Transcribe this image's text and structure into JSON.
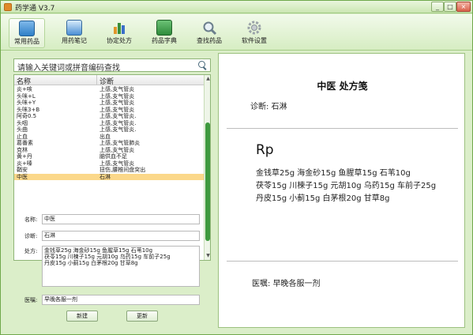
{
  "window": {
    "title": "药学通 V3.7",
    "controls": {
      "minimize": "_",
      "maximize": "□",
      "close": "×"
    }
  },
  "toolbar": {
    "items": [
      {
        "label": "常用药品",
        "icon": "pill-box-icon",
        "color": "#2f7fc7",
        "active": true
      },
      {
        "label": "用药笔记",
        "icon": "notebook-icon",
        "color": "#4a8fd4",
        "active": false
      },
      {
        "label": "协定处方",
        "icon": "bar-chart-icon",
        "color": "#e0962b",
        "active": false
      },
      {
        "label": "药品字典",
        "icon": "green-book-icon",
        "color": "#2e8b3a",
        "active": false
      },
      {
        "label": "查找药品",
        "icon": "magnifier-icon",
        "color": "#7a8d99",
        "active": false
      },
      {
        "label": "软件设置",
        "icon": "gear-icon",
        "color": "#9aa3a8",
        "active": false
      }
    ]
  },
  "search": {
    "text": "请输入关键词或拼音编码查找"
  },
  "list": {
    "headers": {
      "name": "名称",
      "diagnosis": "诊断"
    },
    "rows": [
      {
        "name": "炎+咳",
        "diagnosis": "上感,支气管炎"
      },
      {
        "name": "头咪+L",
        "diagnosis": "上感,支气管炎"
      },
      {
        "name": "头咪+Y",
        "diagnosis": "上感,支气管炎"
      },
      {
        "name": "头咪3+B",
        "diagnosis": "上感,支气管炎"
      },
      {
        "name": "阿奇0.5",
        "diagnosis": "上感,支气管炎."
      },
      {
        "name": "头咽",
        "diagnosis": "上感,支气管炎."
      },
      {
        "name": "头曲",
        "diagnosis": "上感,支气管炎."
      },
      {
        "name": "止血",
        "diagnosis": "出血"
      },
      {
        "name": "葛番素",
        "diagnosis": "上感,支气管肺炎"
      },
      {
        "name": "克林",
        "diagnosis": "上感,支气管炎"
      },
      {
        "name": "黄+丹",
        "diagnosis": "脑供血不足"
      },
      {
        "name": "炎+嗪",
        "diagnosis": "上感,支气管炎"
      },
      {
        "name": "鞘安",
        "diagnosis": "扭伤,腰椎间盘突出"
      },
      {
        "name": "中医",
        "diagnosis": "石淋",
        "selected": true
      }
    ]
  },
  "form": {
    "name_label": "名称:",
    "name_value": "中医",
    "diag_label": "诊断:",
    "diag_value": "石淋",
    "rx_label": "处方:",
    "rx_lines": [
      "金钱草25g  海金砂15g  鱼腥草15g  石苇10g",
      "茯苓15g  川楝子15g  元胡10g  乌药15g  车前子25g",
      "丹皮15g  小蓟15g  白茅根20g  甘草8g"
    ],
    "advice_label": "医嘱:",
    "advice_value": "早晚各服一剂",
    "new_button": "新建",
    "update_button": "更新"
  },
  "prescription": {
    "title": "中医  处方笺",
    "diagnosis": "诊断:  石淋",
    "rp": "Rp",
    "lines": [
      "金钱草25g 海金砂15g 鱼腥草15g 石苇10g",
      "茯苓15g 川楝子15g 元胡10g 乌药15g 车前子25g",
      "丹皮15g 小蓟15g 白茅根20g 甘草8g"
    ],
    "advice": "医嘱:  早晚各服一剂"
  }
}
